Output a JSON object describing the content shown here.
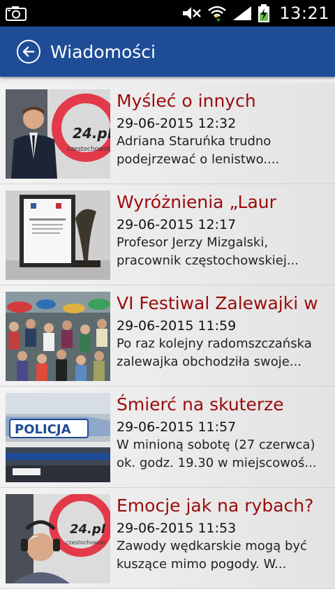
{
  "status_bar": {
    "time": "13:21",
    "icons": [
      "camera-icon",
      "mute-icon",
      "wifi-icon",
      "signal-icon",
      "battery-charging-icon"
    ]
  },
  "app_bar": {
    "title": "Wiadomości",
    "back_icon": "back-arrow-icon",
    "background": "#1e4c96"
  },
  "colors": {
    "title": "#9b0b0b",
    "text": "#222222"
  },
  "news": [
    {
      "title": "Myśleć o innych",
      "date": "29-06-2015 12:32",
      "excerpt": "Adriana Staruńka trudno podejrzewać o lenistwo....",
      "thumb_caption": "24.pl",
      "thumb_subcaption": "czestochowski"
    },
    {
      "title": "Wyróżnienia „Laur",
      "date": "29-06-2015 12:17",
      "excerpt": "Profesor Jerzy Mizgalski, pracownik częstochowskiej..."
    },
    {
      "title": "VI Festiwal Zalewajki w",
      "date": "29-06-2015 11:59",
      "excerpt": "Po raz kolejny radomszczańska zalewajka obchodziła swoje..."
    },
    {
      "title": "Śmierć na skuterze",
      "date": "29-06-2015 11:57",
      "excerpt": "W minioną sobotę (27 czerwca) ok. godz. 19.30 w miejscowoś...",
      "thumb_caption": "POLICJA"
    },
    {
      "title": "Emocje jak na rybach?",
      "date": "29-06-2015 11:53",
      "excerpt": "Zawody wędkarskie mogą być kuszące mimo pogody. W...",
      "thumb_caption": "24.pl",
      "thumb_subcaption": "czestochowski"
    }
  ]
}
